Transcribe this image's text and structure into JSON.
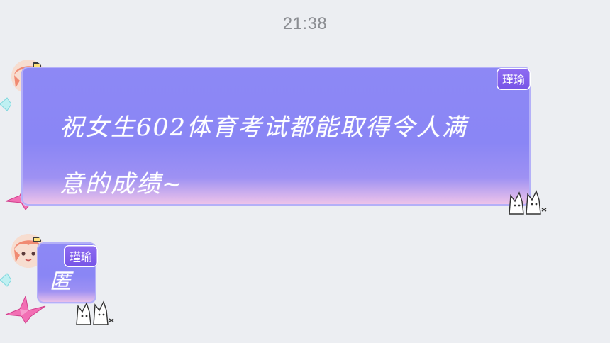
{
  "timestamp": "21:38",
  "messages": [
    {
      "sender_tag": "瑾瑜",
      "text": "祝女生602体育考试都能取得令人满意的成绩~"
    },
    {
      "sender_tag": "瑾瑜",
      "text": "匿"
    }
  ],
  "colors": {
    "background": "#eceef2",
    "bubble_top": "#8d88f5",
    "bubble_bottom": "#f2c6e9",
    "name_tag": "#7654e6",
    "timestamp": "#8b8d92"
  },
  "icons": {
    "avatar": "anime-girl-avatar-icon",
    "crane": "paper-crane-icon",
    "cat": "cat-sticker-icon",
    "deco": "teal-diamond-icon"
  }
}
